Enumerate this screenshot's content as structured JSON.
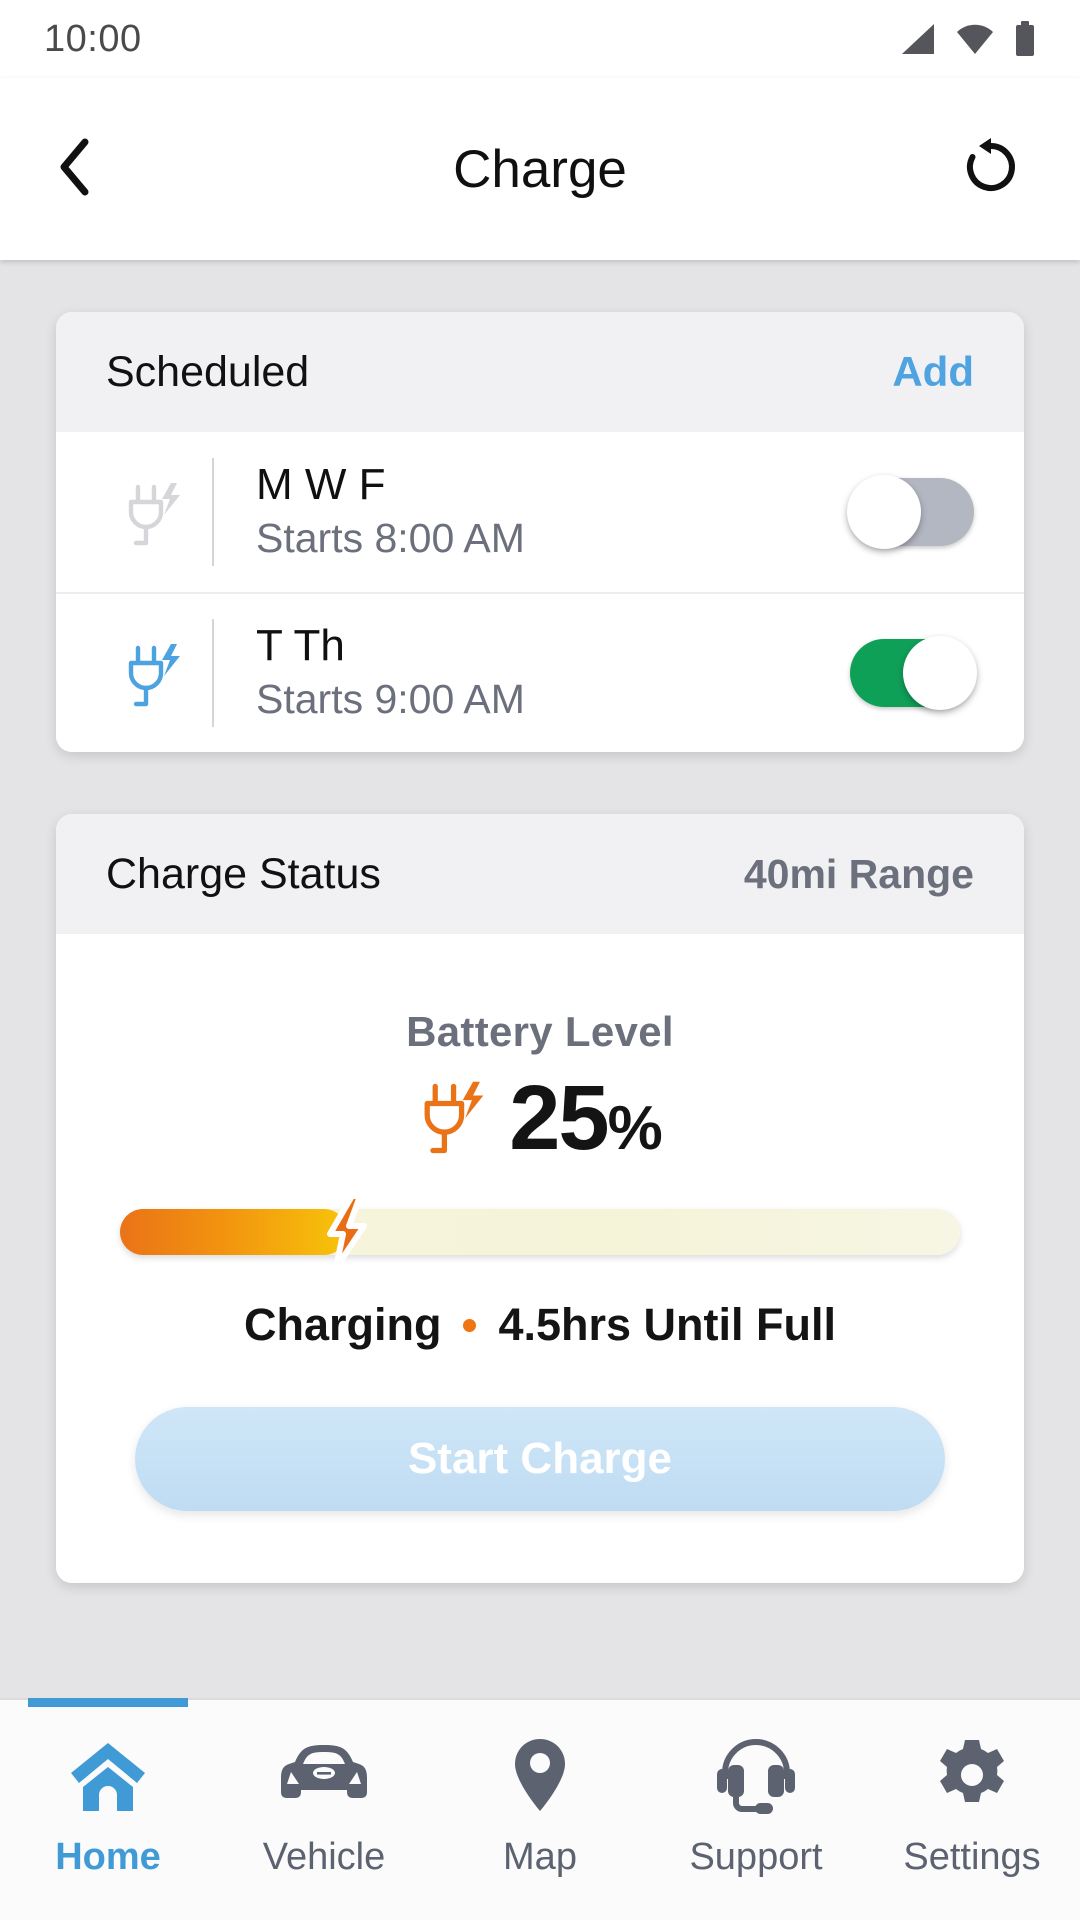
{
  "status_bar": {
    "time": "10:00",
    "icons": [
      "signal-icon",
      "wifi-icon",
      "battery-icon"
    ]
  },
  "app_bar": {
    "back_icon": "chevron-left-icon",
    "title": "Charge",
    "refresh_icon": "rotate-left-icon"
  },
  "scheduled_card": {
    "title": "Scheduled",
    "add_label": "Add",
    "rows": [
      {
        "icon": "plug-bolt-icon",
        "icon_color": "#d6d6da",
        "days": "M W F",
        "time": "Starts 8:00 AM",
        "enabled": false
      },
      {
        "icon": "plug-bolt-icon",
        "icon_color": "#4da2e0",
        "days": "T Th",
        "time": "Starts 9:00 AM",
        "enabled": true
      }
    ]
  },
  "charge_status_card": {
    "title": "Charge Status",
    "range": "40mi Range",
    "battery_label": "Battery Level",
    "plug_icon": "plug-bolt-icon",
    "battery_percent_value": "25",
    "battery_percent_unit": "%",
    "progress_percent": 27,
    "bolt_icon": "lightning-bolt-icon",
    "state_label": "Charging",
    "eta_label": "4.5hrs Until Full",
    "start_button_label": "Start Charge",
    "start_button_enabled": false
  },
  "bottom_nav": {
    "items": [
      {
        "label": "Home",
        "icon": "home-icon",
        "active": true
      },
      {
        "label": "Vehicle",
        "icon": "car-icon",
        "active": false
      },
      {
        "label": "Map",
        "icon": "map-pin-icon",
        "active": false
      },
      {
        "label": "Support",
        "icon": "headset-icon",
        "active": false
      },
      {
        "label": "Settings",
        "icon": "gear-icon",
        "active": false
      }
    ]
  },
  "colors": {
    "accent_blue": "#3f9ad6",
    "link_blue": "#4fa3e0",
    "toggle_on_green": "#0fa058",
    "toggle_off_gray": "#b3b7c2",
    "charge_orange": "#ea7317",
    "page_background": "#e4e4e6",
    "card_header": "#f1f1f4"
  }
}
